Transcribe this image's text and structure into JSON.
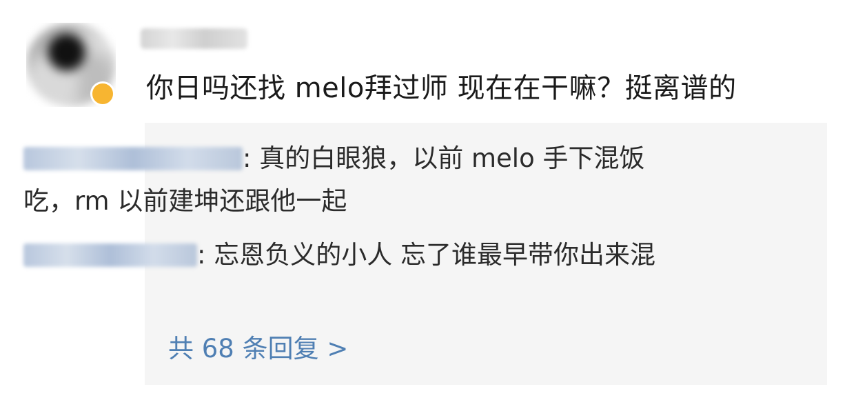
{
  "comment": {
    "text": "你日吗还找 melo拜过师 现在在干嘛？挺离谱的"
  },
  "replies": [
    {
      "text": "真的白眼狼，以前 melo 手下混饭吃，rm 以前建坤还跟他一起"
    },
    {
      "text": "忘恩负义的小人 忘了谁最早带你出来混"
    }
  ],
  "more_replies_label": "共 68 条回复 >",
  "colors": {
    "link": "#4f7fb3",
    "reply_bg": "#f5f5f5",
    "badge": "#f7b531"
  }
}
